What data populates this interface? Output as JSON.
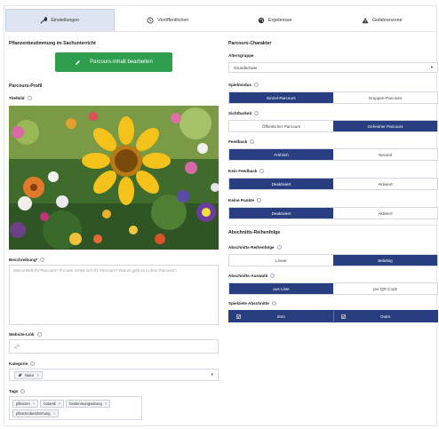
{
  "tabs": [
    {
      "label": "Einstellungen",
      "icon": "wrench-icon",
      "active": true
    },
    {
      "label": "Veröffentlichen",
      "icon": "clock-icon",
      "active": false
    },
    {
      "label": "Ergebnisse",
      "icon": "palette-icon",
      "active": false
    },
    {
      "label": "Gefahrenzone",
      "icon": "warning-icon",
      "active": false
    }
  ],
  "left": {
    "plant_section": "Pflanzenbestimmung im Sachunterricht",
    "edit_button": "Parcours-Inhalt bearbeiten",
    "profile_title": "Parcours-Profil",
    "image_label": "Titelbild",
    "description_label": "Beschreibung*",
    "description_placeholder": "Was erstellt Ihr Parcours? Für wen richtet sich Ihr Parcours? Warum geht es in dem Parcours?",
    "website_label": "Website-Link",
    "category_label": "Kategorie",
    "category_value": "Natur",
    "tags_label": "Tags",
    "tags": [
      "pflanzen",
      "botanik",
      "bestimmungsübung",
      "pflanzenbestimmung"
    ]
  },
  "right": {
    "character_title": "Parcours-Charakter",
    "age_label": "Altersgruppe",
    "age_value": "Grundschule",
    "mode_label": "Spielmodus",
    "mode_options": [
      "Einzel-Parcours",
      "Gruppen-Parcours"
    ],
    "visibility_label": "Sichtbarkeit",
    "visibility_options": [
      "Öffentlicher Parcours",
      "Geheimer Parcours"
    ],
    "feedback_label": "Feedback",
    "feedback_options": [
      "Fröhlich",
      "Neutral"
    ],
    "no_feedback_label": "Kein Feedback",
    "no_feedback_options": [
      "Deaktiviert",
      "Aktiviert"
    ],
    "no_points_label": "Keine Punkte",
    "no_points_options": [
      "Deaktiviert",
      "Aktiviert"
    ],
    "order_title": "Abschnitts-Reihenfolge",
    "order_label": "Abschnitts-Reihenfolge",
    "order_options": [
      "Linear",
      "Beliebig"
    ],
    "selection_label": "Abschnitts-Auswahl",
    "selection_options": [
      "aus Liste",
      "per QR-Code"
    ],
    "game_sections_label": "Spielziele Abschnitte",
    "game_sections_options": [
      "Intro",
      "Outro"
    ]
  }
}
